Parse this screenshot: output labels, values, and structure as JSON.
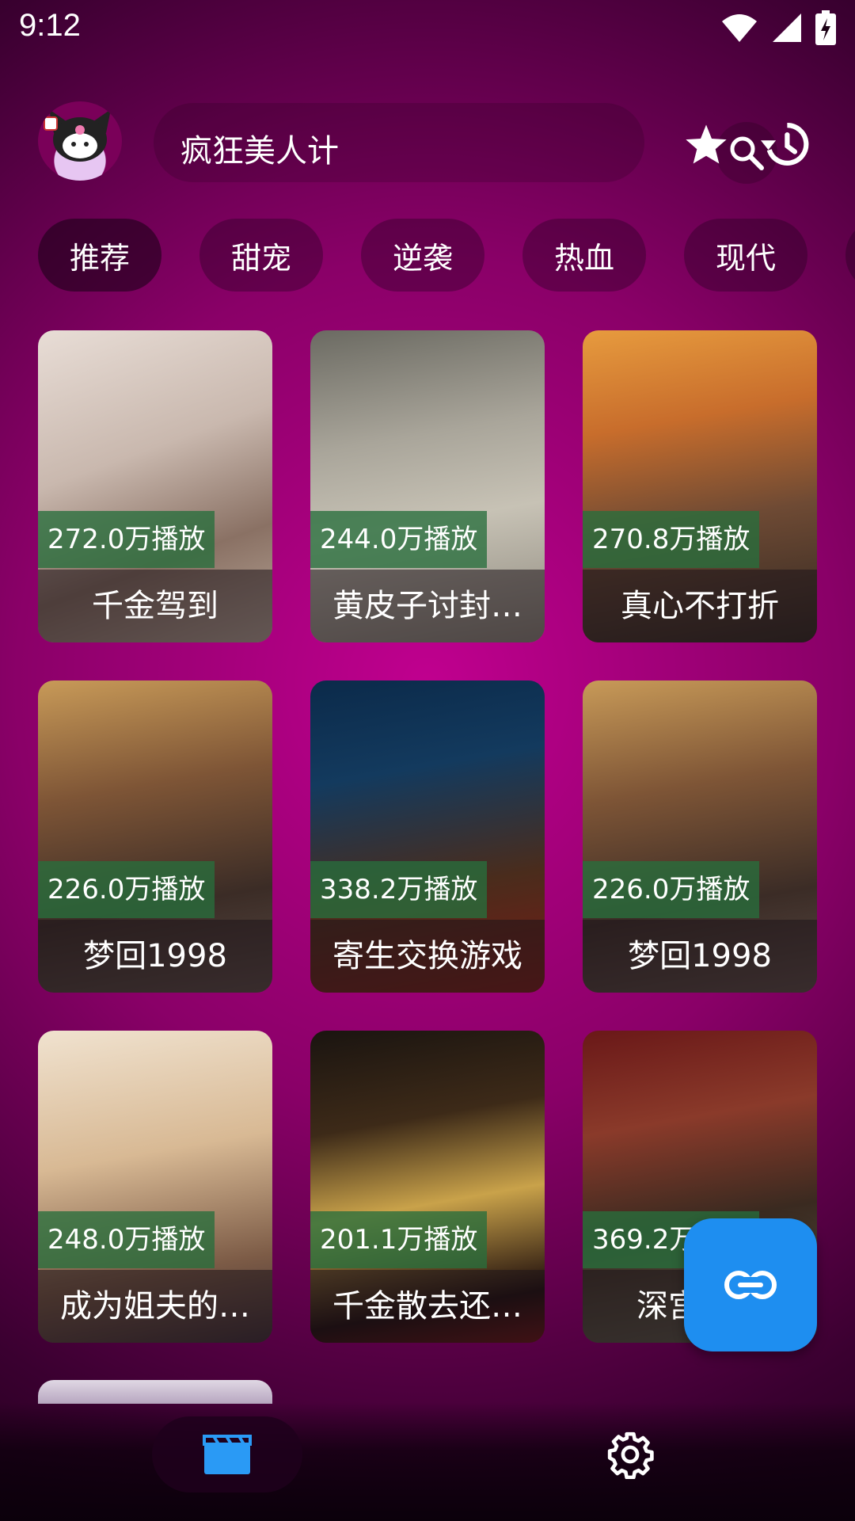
{
  "status_bar": {
    "time": "9:12"
  },
  "header": {
    "search_text": "疯狂美人计",
    "icons": [
      "search-icon",
      "star-icon",
      "history-icon"
    ]
  },
  "categories": [
    {
      "label": "推荐",
      "active": true
    },
    {
      "label": "甜宠"
    },
    {
      "label": "逆袭"
    },
    {
      "label": "热血"
    },
    {
      "label": "现代"
    }
  ],
  "cards": [
    {
      "plays": "272.0万播放",
      "title": "千金驾到"
    },
    {
      "plays": "244.0万播放",
      "title": "黄皮子讨封…"
    },
    {
      "plays": "270.8万播放",
      "title": "真心不打折"
    },
    {
      "plays": "226.0万播放",
      "title": "梦回1998"
    },
    {
      "plays": "338.2万播放",
      "title": "寄生交换游戏"
    },
    {
      "plays": "226.0万播放",
      "title": "梦回1998"
    },
    {
      "plays": "248.0万播放",
      "title": "成为姐夫的…"
    },
    {
      "plays": "201.1万播放",
      "title": "千金散去还…"
    },
    {
      "plays": "369.2万播放",
      "title": "深宫府…"
    }
  ],
  "fab": {
    "icon": "link-icon"
  },
  "bottom_nav": {
    "items": [
      "video-icon",
      "settings-icon"
    ]
  },
  "colors": {
    "accent": "#1e8ef0",
    "play_badge": "#2e6e3c",
    "background": "#a0007a"
  }
}
